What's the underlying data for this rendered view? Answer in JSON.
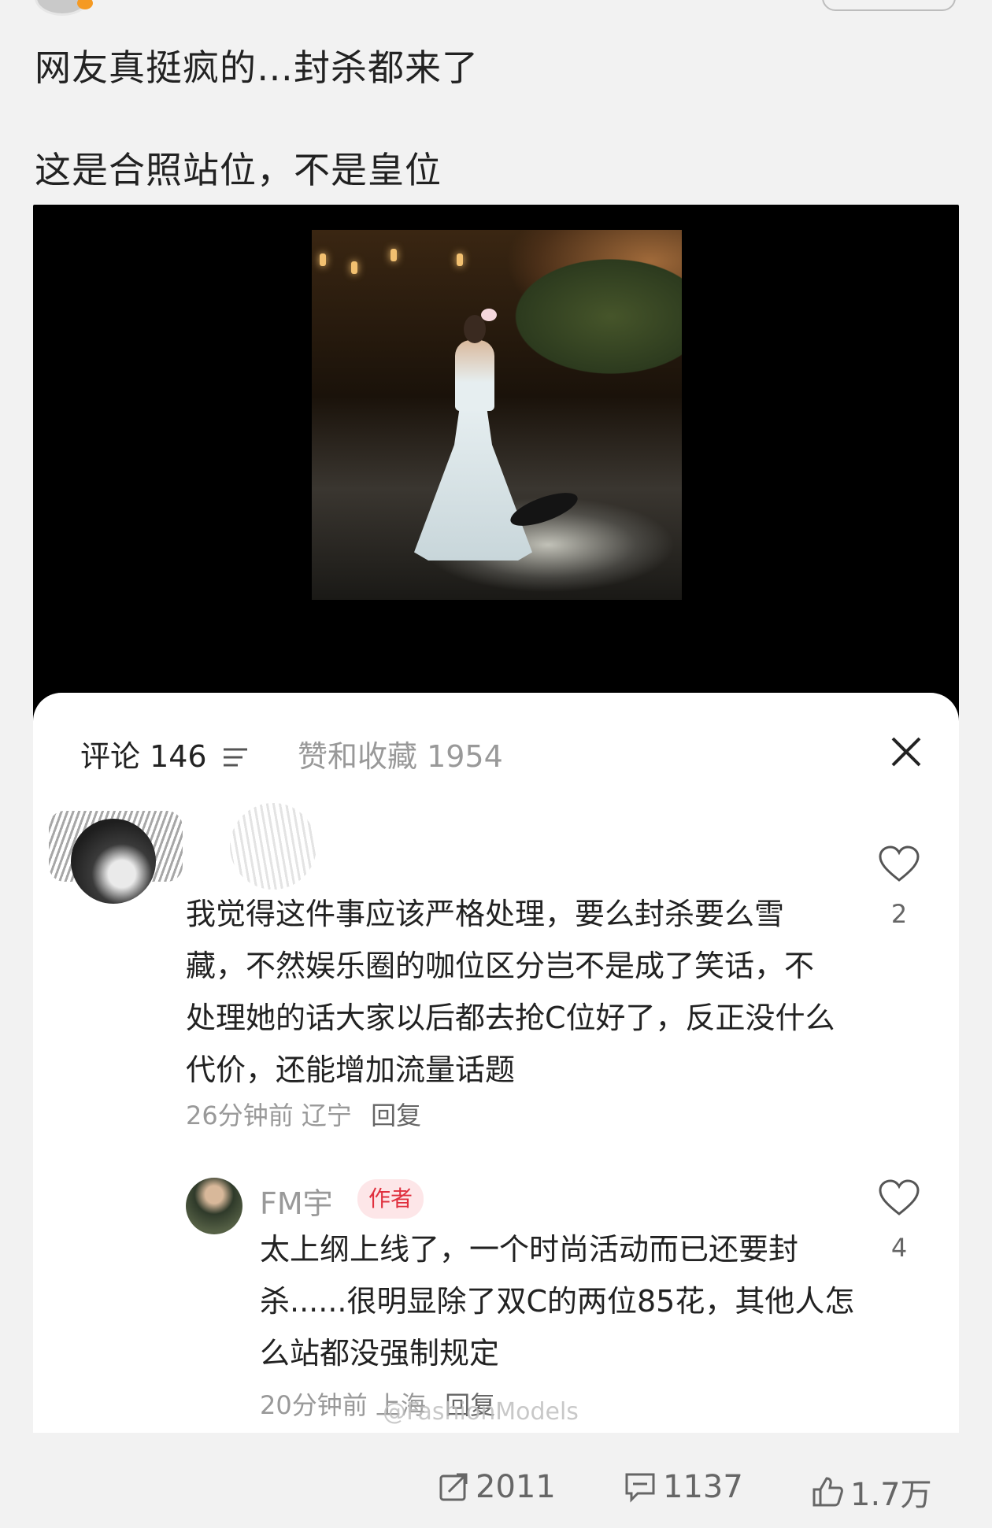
{
  "post": {
    "line1": "网友真挺疯的…封杀都来了",
    "line2": "这是合照站位，不是皇位"
  },
  "panel": {
    "tab_comments": "评论 146",
    "tab_likes": "赞和收藏 1954"
  },
  "comments": [
    {
      "text": "我觉得这件事应该严格处理，要么封杀要么雪藏，不然娱乐圈的咖位区分岂不是成了笑话，不处理她的话大家以后都去抢C位好了，反正没什么代价，还能增加流量话题",
      "time": "26分钟前",
      "location": "辽宁",
      "reply": "回复",
      "likes": "2"
    },
    {
      "name": "FM宇",
      "badge": "作者",
      "text": "太上纲上线了，一个时尚活动而已还要封杀......很明显除了双C的两位85花，其他人怎么站都没强制规定",
      "time": "20分钟前",
      "location": "上海",
      "reply": "回复",
      "likes": "4"
    }
  ],
  "watermark": "@FashionModels",
  "bottom": {
    "shares": "2011",
    "comments": "1137",
    "likes": "1.7万"
  },
  "icons": [
    "filter-icon",
    "close-icon",
    "heart-icon",
    "share-icon",
    "comment-icon",
    "thumbs-up-icon"
  ],
  "colors": {
    "author_badge_bg": "#fde6e8",
    "author_badge_text": "#e0303e"
  }
}
